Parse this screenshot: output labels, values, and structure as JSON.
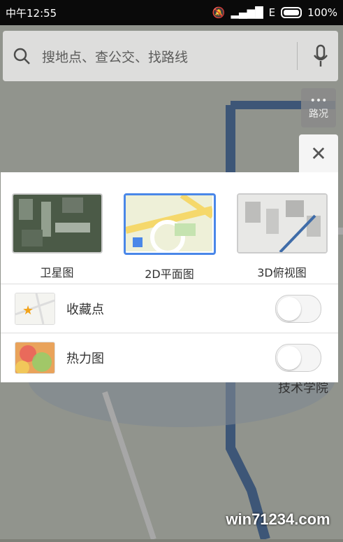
{
  "status": {
    "time": "中午12:55",
    "network": "E",
    "battery": "100%"
  },
  "search": {
    "placeholder": "搜地点、查公交、找路线"
  },
  "road_button": {
    "label": "路况"
  },
  "layers": [
    {
      "label": "卫星图"
    },
    {
      "label": "2D平面图"
    },
    {
      "label": "3D俯视图"
    }
  ],
  "options": [
    {
      "label": "收藏点",
      "enabled": false
    },
    {
      "label": "热力图",
      "enabled": false
    }
  ],
  "map": {
    "label": "技术学院"
  },
  "watermark": "win71234.com"
}
